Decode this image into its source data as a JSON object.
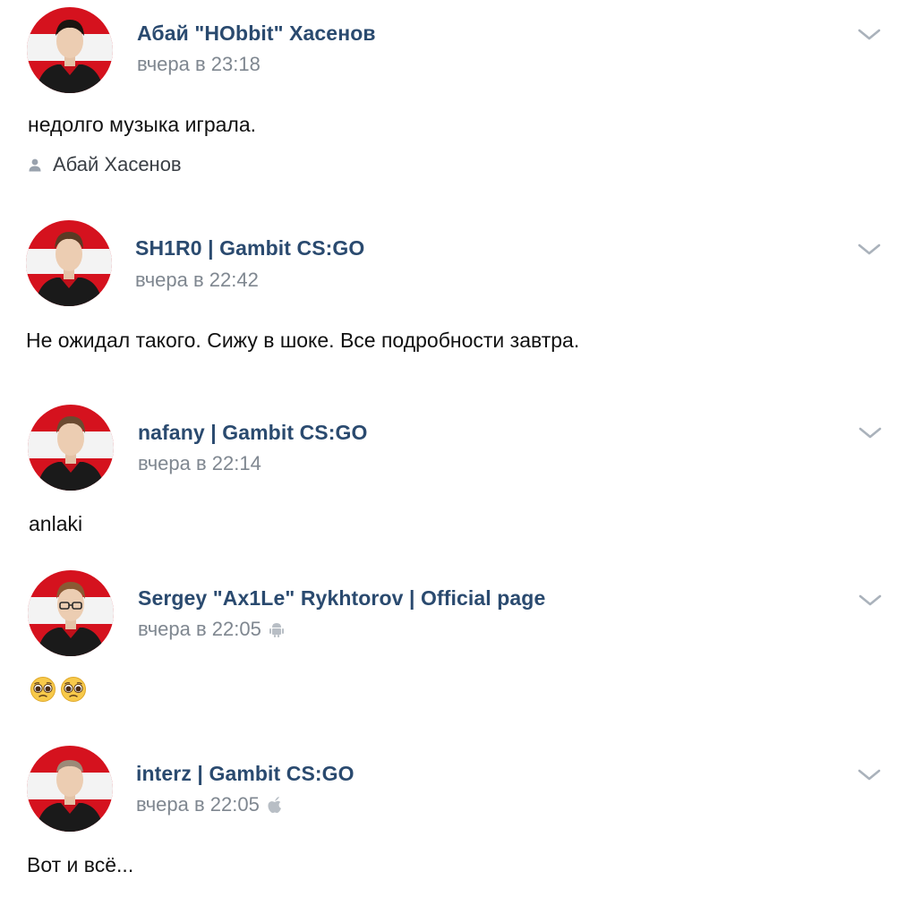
{
  "colors": {
    "author": "#2a4a6f",
    "meta": "#7f8790",
    "text": "#111111",
    "avatar_bg": "#d5121e"
  },
  "posts": [
    {
      "author": "Абай \"HObbit\" Хасенов",
      "time": "вчера в 23:18",
      "text": "недолго музыка играла.",
      "signer": "Абай Хасенов",
      "platform_icon": null,
      "avatar_icon": "player-avatar-icon"
    },
    {
      "author": "SH1R0 | Gambit CS:GO",
      "time": "вчера в 22:42",
      "text": "Не ожидал такого. Сижу в шоке. Все подробности завтра.",
      "platform_icon": null,
      "avatar_icon": "player-avatar-icon"
    },
    {
      "author": "nafany | Gambit CS:GO",
      "time": "вчера в 22:14",
      "text": "anlaki",
      "platform_icon": null,
      "avatar_icon": "player-avatar-icon"
    },
    {
      "author": "Sergey \"Ax1Le\" Rykhtorov | Official page",
      "time": "вчера в 22:05",
      "text": "",
      "emojis": [
        "pleading-face-emoji",
        "pleading-face-emoji"
      ],
      "platform_icon": "android-icon",
      "avatar_icon": "player-avatar-icon"
    },
    {
      "author": "interz | Gambit CS:GO",
      "time": "вчера в 22:05",
      "text": "Вот и всё...",
      "platform_icon": "apple-icon",
      "avatar_icon": "player-avatar-icon"
    }
  ]
}
